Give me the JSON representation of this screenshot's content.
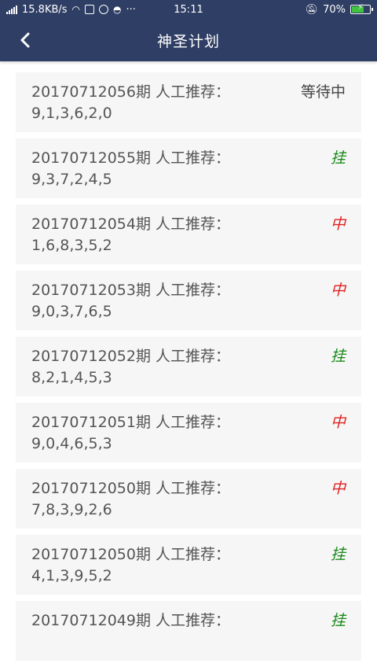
{
  "status_bar": {
    "network_speed": "15.8KB/s",
    "extra_icons": "···",
    "time": "15:11",
    "battery": "70%",
    "battery_level": 0.7
  },
  "header": {
    "title": "神圣计划",
    "back_icon": "chevron-left-icon"
  },
  "colors": {
    "header_bg": "#2f3e64",
    "card_bg": "#f6f6f6",
    "fail": "#1b8a1b",
    "win": "#e02020"
  },
  "items": [
    {
      "period": "20170712056期 人工推荐：",
      "numbers": "9,1,3,6,2,0",
      "status": "等待中",
      "type": "pending"
    },
    {
      "period": "20170712055期 人工推荐：",
      "numbers": "9,3,7,2,4,5",
      "status": "挂",
      "type": "fail"
    },
    {
      "period": "20170712054期 人工推荐：",
      "numbers": "1,6,8,3,5,2",
      "status": "中",
      "type": "win"
    },
    {
      "period": "20170712053期 人工推荐：",
      "numbers": "9,0,3,7,6,5",
      "status": "中",
      "type": "win"
    },
    {
      "period": "20170712052期 人工推荐：",
      "numbers": "8,2,1,4,5,3",
      "status": "挂",
      "type": "fail"
    },
    {
      "period": "20170712051期 人工推荐：",
      "numbers": "9,0,4,6,5,3",
      "status": "中",
      "type": "win"
    },
    {
      "period": "20170712050期 人工推荐：",
      "numbers": "7,8,3,9,2,6",
      "status": "中",
      "type": "win"
    },
    {
      "period": "20170712050期 人工推荐：",
      "numbers": "4,1,3,9,5,2",
      "status": "挂",
      "type": "fail"
    },
    {
      "period": "20170712049期 人工推荐：",
      "numbers": "",
      "status": "挂",
      "type": "fail"
    }
  ]
}
